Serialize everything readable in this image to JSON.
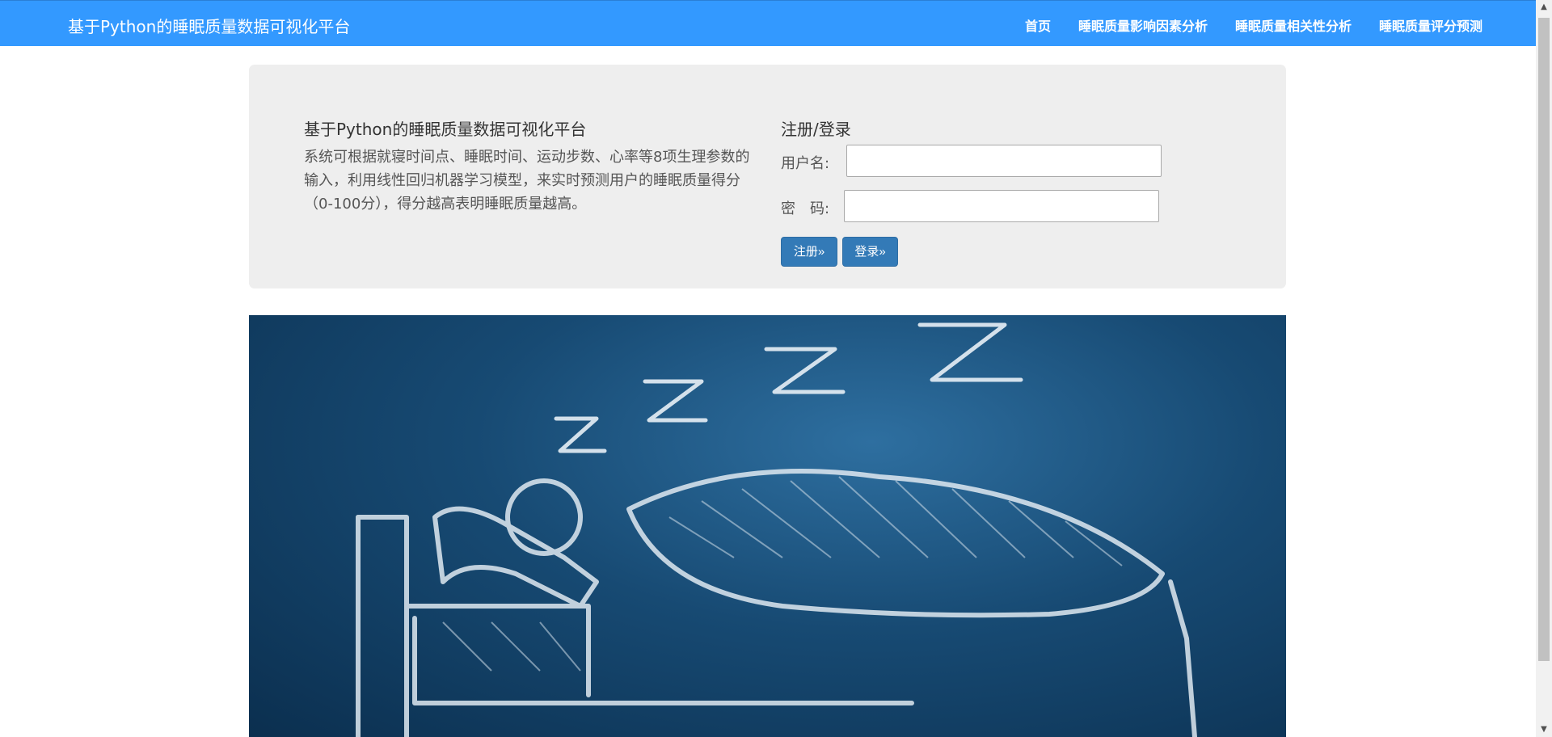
{
  "navbar": {
    "brand": "基于Python的睡眠质量数据可视化平台",
    "links": [
      "首页",
      "睡眠质量影响因素分析",
      "睡眠质量相关性分析",
      "睡眠质量评分预测"
    ]
  },
  "intro": {
    "title": "基于Python的睡眠质量数据可视化平台",
    "description": "系统可根据就寝时间点、睡眠时间、运动步数、心率等8项生理参数的输入，利用线性回归机器学习模型，来实时预测用户的睡眠质量得分（0-100分），得分越高表明睡眠质量越高。"
  },
  "login": {
    "title": "注册/登录",
    "username_label": "用户名:",
    "username_value": "",
    "password_label": "密　码:",
    "password_value": "",
    "register_label": "注册»",
    "login_label": "登录»"
  },
  "hero": {
    "icon": "sleeping-person-illustration"
  },
  "colors": {
    "navbar": "#3399ff",
    "button": "#337ab7",
    "jumbotron": "#eeeeee"
  }
}
